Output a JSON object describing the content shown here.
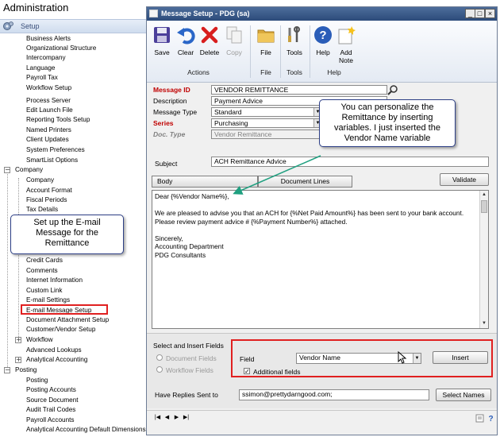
{
  "nav": {
    "title": "Administration",
    "setup_label": "Setup",
    "setup_items_a": [
      "Business Alerts",
      "Organizational Structure",
      "Intercompany",
      "Language",
      "Payroll Tax",
      "Workflow Setup"
    ],
    "setup_items_b": [
      "Process Server",
      "Edit Launch File",
      "Reporting Tools Setup",
      "Named Printers",
      "Client Updates",
      "System Preferences",
      "SmartList Options"
    ],
    "company_label": "Company",
    "company_items_a": [
      "Company",
      "Account Format",
      "Fiscal Periods",
      "Tax Details"
    ],
    "company_items_b": [
      "Credit Cards",
      "Comments",
      "Internet Information",
      "Custom Link",
      "E-mail Settings",
      "E-mail Message Setup",
      "Document Attachment Setup",
      "Customer/Vendor Setup"
    ],
    "workflow_label": "Workflow",
    "advanced_lookups": "Advanced Lookups",
    "analytical_label": "Analytical Accounting",
    "posting_label": "Posting",
    "posting_items": [
      "Posting",
      "Posting Accounts",
      "Source Document",
      "Audit Trail Codes",
      "Payroll Accounts",
      "Analytical Accounting Default Dimensions"
    ]
  },
  "callouts": {
    "left": "Set up the E-mail Message for the Remittance",
    "right": "You can personalize the Remittance by inserting variables. I just inserted the Vendor Name variable"
  },
  "window": {
    "title": "Message Setup  -  PDG (sa)",
    "ribbon": {
      "save": "Save",
      "clear": "Clear",
      "delete": "Delete",
      "copy": "Copy",
      "actions_group": "Actions",
      "file": "File",
      "file_group": "File",
      "tools": "Tools",
      "tools_group": "Tools",
      "help": "Help",
      "add_note_line1": "Add",
      "add_note_line2": "Note",
      "help_group": "Help"
    },
    "form": {
      "message_id_label": "Message ID",
      "message_id": "VENDOR REMITTANCE",
      "description_label": "Description",
      "description": "Payment Advice",
      "message_type_label": "Message Type",
      "message_type": "Standard",
      "series_label": "Series",
      "series": "Purchasing",
      "doc_type_label": "Doc. Type",
      "doc_type": "Vendor Remittance",
      "subject_label": "Subject",
      "subject": "ACH Remittance Advice"
    },
    "tabs": {
      "body": "Body",
      "document_lines": "Document Lines",
      "validate": "Validate"
    },
    "body_lines": [
      "Dear {%Vendor Name%},",
      "",
      "We are pleased to advise you that an ACH for {%Net Paid Amount%} has been sent to your bank account.",
      "Please review payment advice # {%Payment Number%} attached.",
      "",
      "Sincerely,",
      "Accounting Department",
      "PDG Consultants"
    ],
    "insert": {
      "section_label": "Select and Insert Fields",
      "document_fields": "Document Fields",
      "workflow_fields": "Workflow Fields",
      "field_label": "Field",
      "field_value": "Vendor Name",
      "insert_button": "Insert",
      "additional_fields": "Additional fields"
    },
    "replies": {
      "label": "Have Replies Sent to",
      "email": "ssimon@prettydarngood.com;",
      "select_names": "Select Names"
    }
  },
  "colors": {
    "titlebar": "#2c4b7a",
    "required_label": "#c00000",
    "highlight": "#e02020",
    "arrow": "#20a080"
  }
}
